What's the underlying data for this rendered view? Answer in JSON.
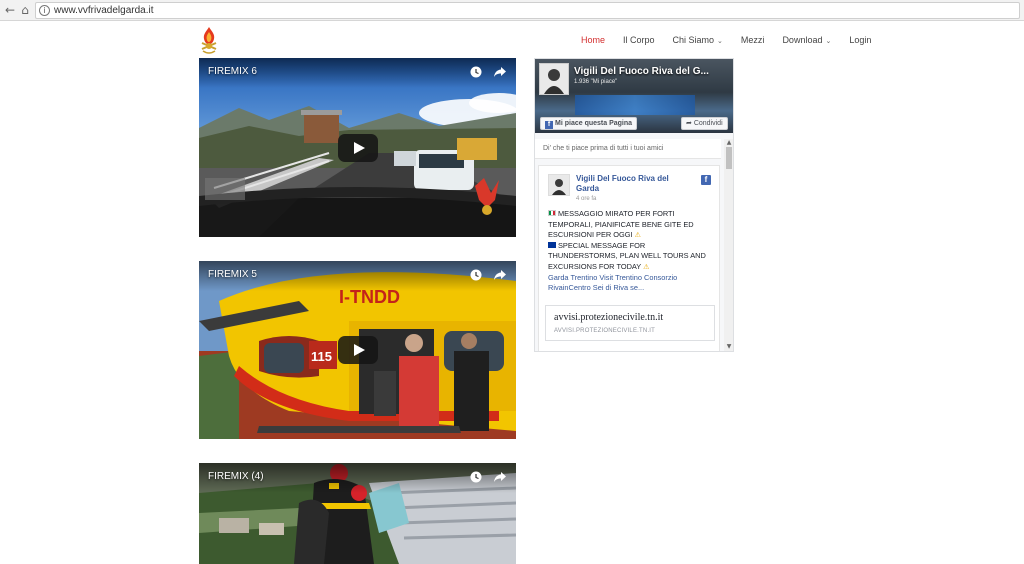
{
  "browser": {
    "url": "www.vvfrivadelgarda.it",
    "back_icon": "back-arrow-icon",
    "home_icon": "home-icon"
  },
  "site": {
    "logo_icon": "firefighter-logo-icon",
    "nav": [
      {
        "label": "Home",
        "active": true,
        "dropdown": false
      },
      {
        "label": "Il Corpo",
        "active": false,
        "dropdown": false
      },
      {
        "label": "Chi Siamo",
        "active": false,
        "dropdown": true
      },
      {
        "label": "Mezzi",
        "active": false,
        "dropdown": false
      },
      {
        "label": "Download",
        "active": false,
        "dropdown": true
      },
      {
        "label": "Login",
        "active": false,
        "dropdown": false
      }
    ],
    "accent_color": "#d32f2f"
  },
  "videos": [
    {
      "title": "FIREMIX 6"
    },
    {
      "title": "FIREMIX 5"
    },
    {
      "title": "FIREMIX (4)"
    }
  ],
  "facebook": {
    "page_name": "Vigili Del Fuoco Riva del G...",
    "likes_text": "1.936 \"Mi piace\"",
    "like_button": "Mi piace questa Pagina",
    "share_button": "Condividi",
    "friends_text": "Di' che ti piace prima di tutti i tuoi amici",
    "post": {
      "author": "Vigili Del Fuoco Riva del Garda",
      "time": "4 ore fa",
      "text_it": "MESSAGGIO MIRATO PER FORTI TEMPORALI, PIANIFICATE BENE GITE ED ESCURSIONI PER OGGI",
      "text_en": "SPECIAL MESSAGE FOR THUNDERSTORMS, PLAN WELL TOURS AND EXCURSIONS FOR TODAY",
      "tags": "Garda Trentino Visit Trentino Consorzio RivainCentro Sei di Riva se...",
      "link_title": "avvisi.protezionecivile.tn.it",
      "link_domain": "AVVISI.PROTEZIONECIVILE.TN.IT"
    }
  }
}
